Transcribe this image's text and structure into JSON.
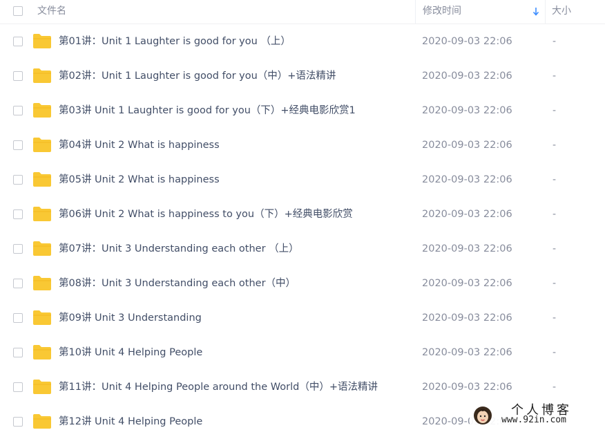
{
  "header": {
    "name_label": "文件名",
    "time_label": "修改时间",
    "size_label": "大小"
  },
  "colors": {
    "folder": "#f9c834",
    "sort_arrow": "#3b8cff",
    "text_primary": "#424e67",
    "text_secondary": "#878c9c"
  },
  "files": [
    {
      "name": "第01讲：Unit 1 Laughter is good for you （上）",
      "time": "2020-09-03 22:06",
      "size": "-"
    },
    {
      "name": "第02讲：Unit 1 Laughter is good for you（中）+语法精讲",
      "time": "2020-09-03 22:06",
      "size": "-"
    },
    {
      "name": "第03讲 Unit 1 Laughter is good for you（下）+经典电影欣赏1",
      "time": "2020-09-03 22:06",
      "size": "-"
    },
    {
      "name": "第04讲 Unit 2 What is happiness",
      "time": "2020-09-03 22:06",
      "size": "-"
    },
    {
      "name": "第05讲 Unit 2 What is happiness",
      "time": "2020-09-03 22:06",
      "size": "-"
    },
    {
      "name": "第06讲 Unit 2 What is happiness to you（下）+经典电影欣赏",
      "time": "2020-09-03 22:06",
      "size": "-"
    },
    {
      "name": "第07讲：Unit 3 Understanding each other （上）",
      "time": "2020-09-03 22:06",
      "size": "-"
    },
    {
      "name": "第08讲：Unit 3 Understanding each other（中）",
      "time": "2020-09-03 22:06",
      "size": "-"
    },
    {
      "name": "第09讲 Unit 3 Understanding",
      "time": "2020-09-03 22:06",
      "size": "-"
    },
    {
      "name": "第10讲 Unit 4 Helping People",
      "time": "2020-09-03 22:06",
      "size": "-"
    },
    {
      "name": "第11讲：Unit 4 Helping People around the World（中）+语法精讲",
      "time": "2020-09-03 22:06",
      "size": "-"
    },
    {
      "name": "第12讲 Unit 4 Helping People",
      "time": "2020-09-03 22:06",
      "size": "-"
    }
  ],
  "watermark": {
    "title": "个人博客",
    "url": "www.92in.com"
  }
}
